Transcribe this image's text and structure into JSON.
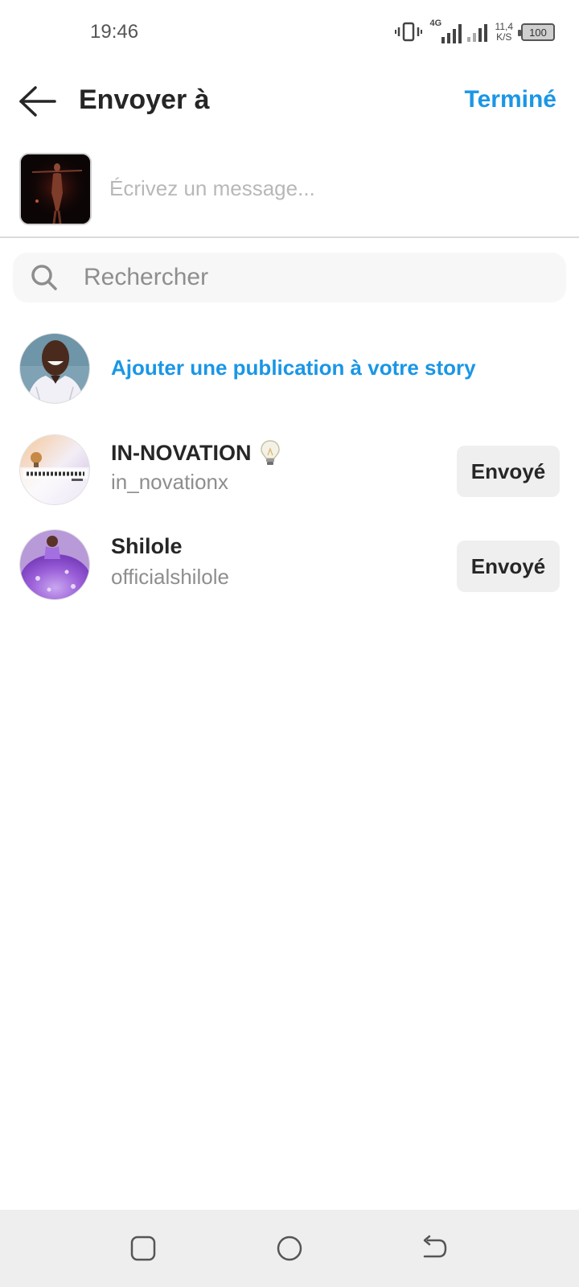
{
  "status_bar": {
    "time": "19:46",
    "network_label": "4G",
    "speed_value": "11,4",
    "speed_unit": "K/S",
    "battery": "100"
  },
  "header": {
    "title": "Envoyer à",
    "done_label": "Terminé"
  },
  "composer": {
    "placeholder": "Écrivez un message..."
  },
  "search": {
    "placeholder": "Rechercher"
  },
  "story": {
    "label": "Ajouter une publication à votre story"
  },
  "recipients": [
    {
      "name": "IN-NOVATION",
      "username": "in_novationx",
      "status": "Envoyé",
      "badge_icon": "lightbulb-icon"
    },
    {
      "name": "Shilole",
      "username": "officialshilole",
      "status": "Envoyé"
    }
  ],
  "colors": {
    "accent": "#1a96e6",
    "text_primary": "#262626",
    "text_secondary": "#8e8e8e",
    "button_bg": "#efefef",
    "nav_bg": "#eeeeee"
  },
  "icons": {
    "back": "arrow-left-icon",
    "search": "search-icon",
    "nav_recents": "square-icon",
    "nav_home": "circle-icon",
    "nav_back": "return-arrow-icon"
  }
}
